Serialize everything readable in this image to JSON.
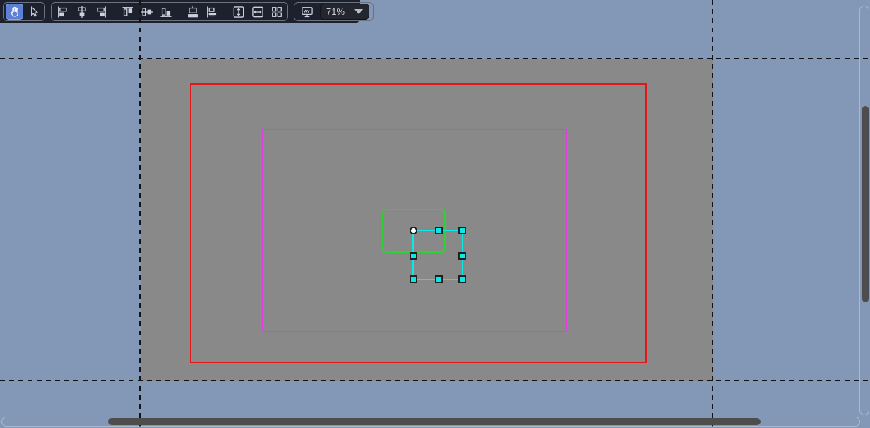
{
  "app": {
    "description": "vector canvas editor with alignment toolbar"
  },
  "toolbar": {
    "tool_group": [
      {
        "icon": "hand-icon",
        "name": "hand-tool",
        "selected": true
      },
      {
        "icon": "pointer-icon",
        "name": "pointer-tool",
        "selected": false
      }
    ],
    "align_group": {
      "icons": [
        "align-left-icon",
        "align-center-horizontal-icon",
        "align-right-icon",
        "align-top-icon",
        "align-middle-vertical-icon",
        "align-bottom-icon",
        "send-to-bottom-icon",
        "send-to-left-icon",
        "fit-height-icon",
        "fit-width-icon",
        "arrange-grid-icon"
      ]
    },
    "zoom_group": {
      "monitor_icon": "monitor-icon",
      "zoom_value": "71%",
      "dropdown_icon": "chevron-down-icon"
    }
  },
  "canvas": {
    "background_color": "#8298b6",
    "page_color": "#898989",
    "guide_color": "#141414",
    "shapes": {
      "red_rect": {
        "stroke": "#e21717"
      },
      "magenta_rect": {
        "stroke": "#e43ce4"
      },
      "green_rect": {
        "stroke": "#2bd42f"
      }
    },
    "selection": {
      "stroke": "#0ce8e8",
      "handle_fill": "#0ce8e8",
      "handle_border": "#202020",
      "anchor_fill": "#ffffff",
      "handle_count": 8
    }
  },
  "scrollbars": {
    "thumb_color": "#4d4d4d",
    "horizontal_visible": true,
    "vertical_visible": true
  }
}
